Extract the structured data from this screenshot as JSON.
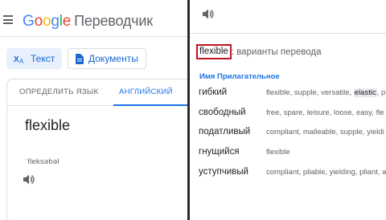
{
  "header": {
    "logo_g": "G",
    "logo_o1": "o",
    "logo_o2": "o",
    "logo_g2": "g",
    "logo_l": "l",
    "logo_e": "e",
    "product": "Переводчик"
  },
  "modes": {
    "text_label": "Текст",
    "docs_label": "Документы"
  },
  "tabs": {
    "detect": "ОПРЕДЕЛИТЬ ЯЗЫК",
    "english": "АНГЛИЙСКИЙ"
  },
  "source": {
    "text": "flexible",
    "transliteration": "ˈfleksəbəl"
  },
  "panel": {
    "highlighted_word": "flexible",
    "variants_suffix": ": варианты перевода",
    "part_of_speech": "Имя Прилагательное",
    "rows": [
      {
        "word": "гибкий",
        "synonyms_pre": "flexible, supple, versatile, ",
        "synonyms_hl": "elastic",
        "synonyms_post": ", pl"
      },
      {
        "word": "свободный",
        "synonyms_pre": "free, spare, leisure, loose, easy, fle",
        "synonyms_hl": "",
        "synonyms_post": ""
      },
      {
        "word": "податливый",
        "synonyms_pre": "compliant, malleable, supple, yieldi",
        "synonyms_hl": "",
        "synonyms_post": ""
      },
      {
        "word": "гнущийся",
        "synonyms_pre": "flexible",
        "synonyms_hl": "",
        "synonyms_post": ""
      },
      {
        "word": "уступчивый",
        "synonyms_pre": "compliant, pliable, yielding, pliant, a",
        "synonyms_hl": "",
        "synonyms_post": ""
      }
    ]
  },
  "colors": {
    "accent": "#1a73e8",
    "highlight_box": "#c0141e",
    "divider": "#2b2b2b"
  },
  "icons": [
    "menu-icon",
    "translate-text-icon",
    "document-icon",
    "speaker-icon"
  ]
}
